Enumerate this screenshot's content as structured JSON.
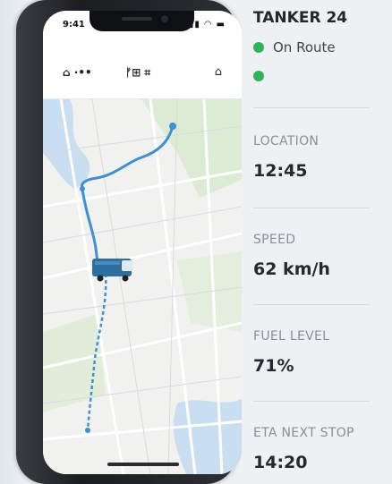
{
  "phone": {
    "status_time": "9:41",
    "status_icons": "▮▮ ◠ ▬",
    "header": {
      "left_label": "⌂ ·••",
      "mid_label": "ᚠ⊞ ⌗",
      "right_icon": "⌂"
    }
  },
  "panel": {
    "title": "TANKER 24",
    "status": "On Route",
    "fields": [
      {
        "label": "LOCATION",
        "value": "12:45"
      },
      {
        "label": "SPEED",
        "value": "62 km/h"
      },
      {
        "label": "FUEL LEVEL",
        "value": "71%"
      },
      {
        "label": "ETA NEXT STOP",
        "value": "14:20"
      }
    ]
  },
  "colors": {
    "status_green": "#2fb35a",
    "route_blue": "#3f8fd2",
    "truck_blue": "#2e6f9e"
  }
}
